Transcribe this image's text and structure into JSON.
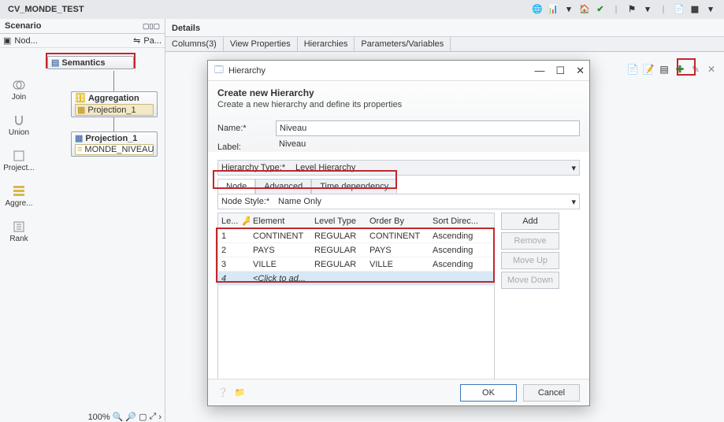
{
  "title": "CV_MONDE_TEST",
  "scenario": {
    "header": "Scenario",
    "node_tab": "Nod...",
    "palette_tab": "Pa...",
    "sem_label": "Semantics",
    "agg_label": "Aggregation",
    "agg_proj": "Projection_1",
    "proj_label": "Projection_1",
    "monde": "MONDE_NIVEAU",
    "zoom": "100%"
  },
  "sidebar": {
    "items": [
      {
        "label": "Join"
      },
      {
        "label": "Union"
      },
      {
        "label": "Project..."
      },
      {
        "label": "Aggre..."
      },
      {
        "label": "Rank"
      }
    ]
  },
  "details": {
    "header": "Details",
    "tabs": [
      "Columns(3)",
      "View Properties",
      "Hierarchies",
      "Parameters/Variables"
    ]
  },
  "dialog": {
    "win_title": "Hierarchy",
    "heading": "Create new Hierarchy",
    "sub": "Create a new hierarchy and define its properties",
    "name_label": "Name:*",
    "name_value": "Niveau",
    "label_label": "Label:",
    "label_value": "Niveau",
    "htype_label": "Hierarchy Type:*",
    "htype_value": "Level Hierarchy",
    "subtabs": [
      "Node",
      "Advanced",
      "Time dependency"
    ],
    "nodestyle_label": "Node Style:*",
    "nodestyle_value": "Name Only",
    "grid": {
      "headers": {
        "le": "Le...",
        "key": "🔑",
        "el": "Element",
        "lt": "Level Type",
        "ob": "Order By",
        "sd": "Sort Direc..."
      },
      "rows": [
        {
          "le": "1",
          "el": "CONTINENT",
          "lt": "REGULAR",
          "ob": "CONTINENT",
          "sd": "Ascending"
        },
        {
          "le": "2",
          "el": "PAYS",
          "lt": "REGULAR",
          "ob": "PAYS",
          "sd": "Ascending"
        },
        {
          "le": "3",
          "el": "VILLE",
          "lt": "REGULAR",
          "ob": "VILLE",
          "sd": "Ascending"
        }
      ],
      "new_row": {
        "le": "4",
        "el": "<Click to ad..."
      }
    },
    "buttons": {
      "add": "Add",
      "remove": "Remove",
      "up": "Move Up",
      "down": "Move Down"
    },
    "footer": {
      "ok": "OK",
      "cancel": "Cancel"
    }
  }
}
